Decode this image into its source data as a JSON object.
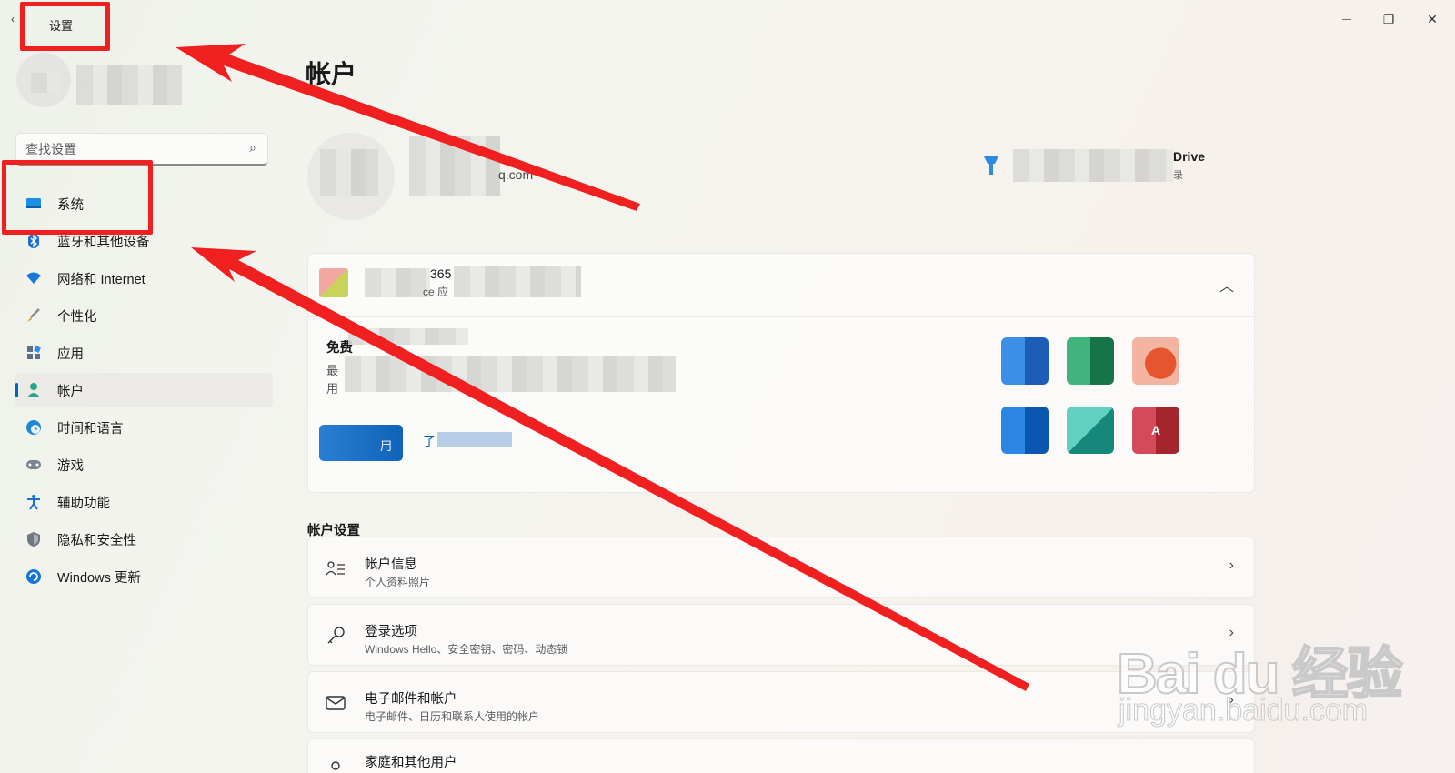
{
  "window": {
    "title": "设置",
    "back_glyph": "‹",
    "minimize_glyph": "—",
    "maximize_glyph": "❐",
    "close_glyph": "✕"
  },
  "sidebar": {
    "search_placeholder": "查找设置",
    "items": [
      {
        "label": "系统",
        "icon": "system-icon",
        "color": "#0a7bd8"
      },
      {
        "label": "蓝牙和其他设备",
        "icon": "bluetooth-icon",
        "color": "#1a6fd1"
      },
      {
        "label": "网络和 Internet",
        "icon": "wifi-icon",
        "color": "#1778d6"
      },
      {
        "label": "个性化",
        "icon": "brush-icon",
        "color": "#e08a2a"
      },
      {
        "label": "应用",
        "icon": "apps-icon",
        "color": "#5b6f86"
      },
      {
        "label": "帐户",
        "icon": "account-icon",
        "color": "#2aa58c",
        "active": true
      },
      {
        "label": "时间和语言",
        "icon": "clock-globe-icon",
        "color": "#1e88d6"
      },
      {
        "label": "游戏",
        "icon": "gamepad-icon",
        "color": "#7a8590"
      },
      {
        "label": "辅助功能",
        "icon": "accessibility-icon",
        "color": "#1a6fd1"
      },
      {
        "label": "隐私和安全性",
        "icon": "shield-icon",
        "color": "#6f7880"
      },
      {
        "label": "Windows 更新",
        "icon": "update-icon",
        "color": "#1777d5"
      }
    ]
  },
  "main": {
    "page_title": "帐户",
    "email_fragment": "q.com",
    "onedrive_fragment": "Drive",
    "onedrive_sub_fragment": "录",
    "office_card": {
      "title_fragment": "365",
      "subtitle_fragment": "ce 应",
      "free_label": "免费",
      "line1_fragment": "最",
      "line2_fragment": "用",
      "button_fragment": "用",
      "link_fragment": "了",
      "collapse_glyph": "︿"
    },
    "section_title": "帐户设置",
    "rows": [
      {
        "title": "帐户信息",
        "subtitle": "个人资料照片",
        "icon": "person-list-icon"
      },
      {
        "title": "登录选项",
        "subtitle": "Windows Hello、安全密钥、密码、动态锁",
        "icon": "key-icon"
      },
      {
        "title": "电子邮件和帐户",
        "subtitle": "电子邮件、日历和联系人使用的帐户",
        "icon": "mail-icon"
      },
      {
        "title": "家庭和其他用户",
        "subtitle": "",
        "icon": "people-icon"
      }
    ],
    "chevron_glyph": "›"
  },
  "watermark": {
    "logo": "Bai du 经验",
    "url": "jingyan.baidu.com"
  },
  "colors": {
    "annotation_red": "#f02020",
    "accent_blue": "#0067c0"
  }
}
